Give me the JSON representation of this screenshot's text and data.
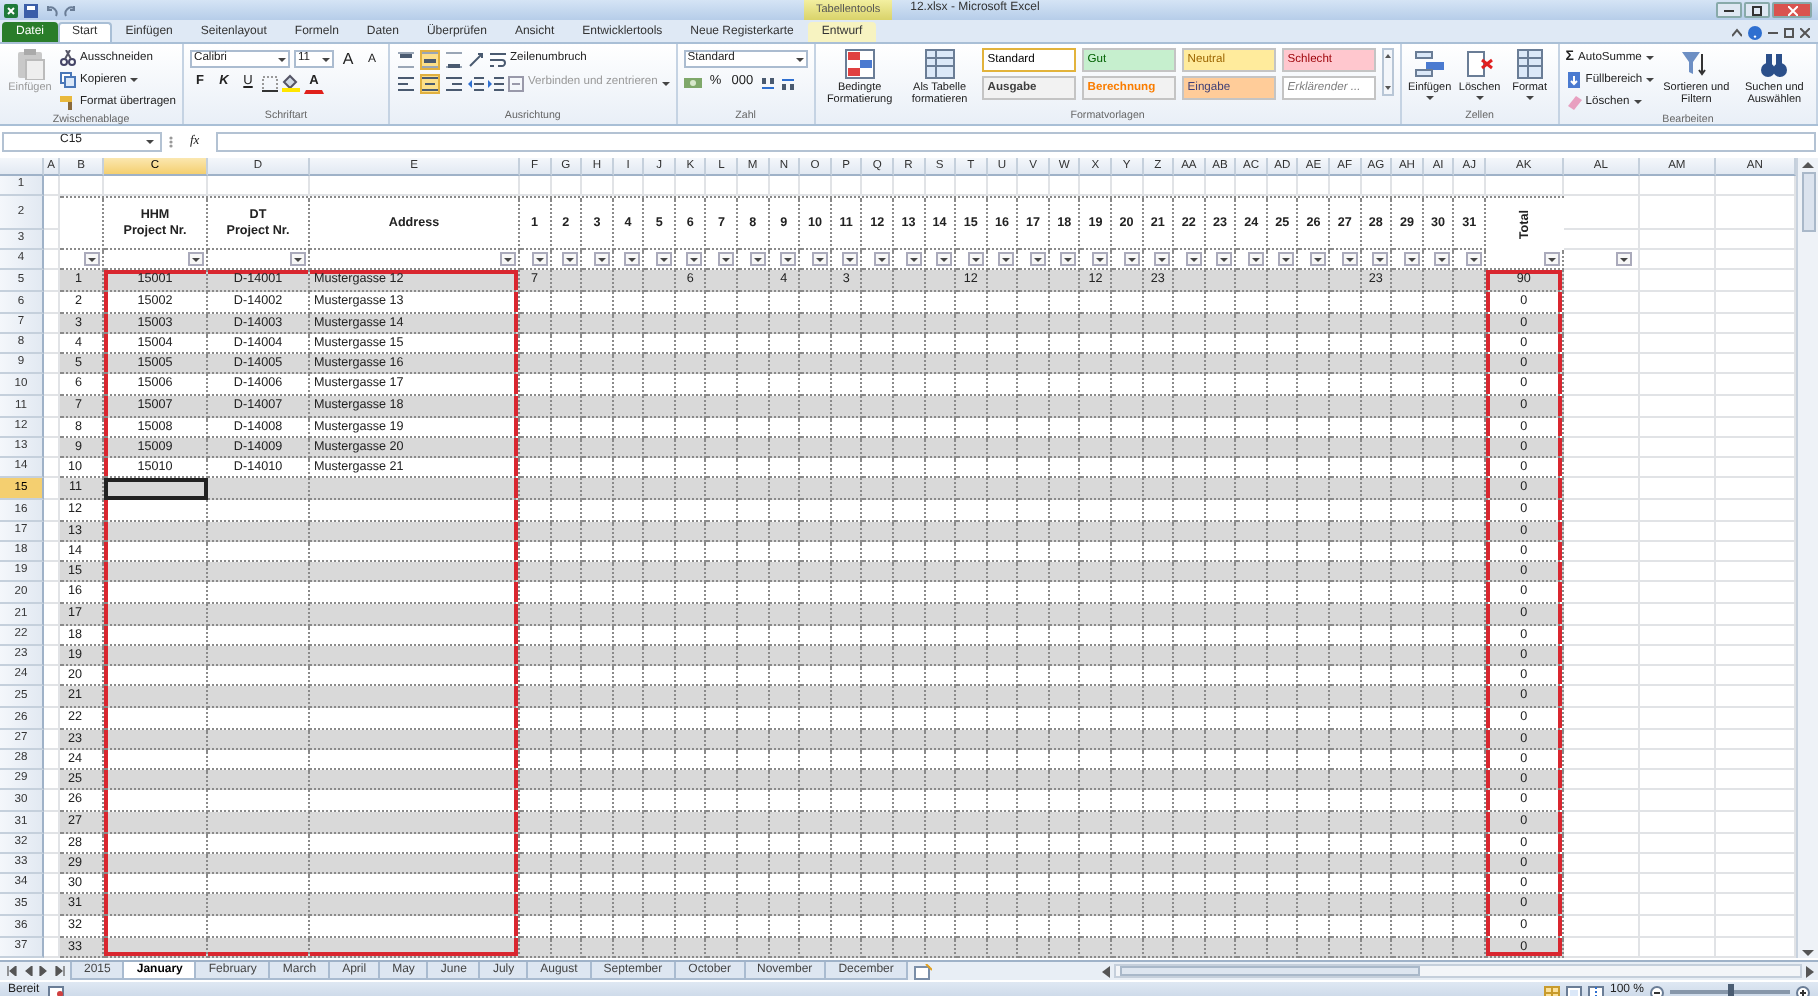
{
  "window": {
    "title": "12.xlsx - Microsoft Excel",
    "context_label": "Tabellentools"
  },
  "ribbon_tabs": [
    {
      "label": "Datei",
      "kind": "file",
      "selected": false
    },
    {
      "label": "Start",
      "kind": "tab",
      "selected": true
    },
    {
      "label": "Einfügen",
      "kind": "tab",
      "selected": false
    },
    {
      "label": "Seitenlayout",
      "kind": "tab",
      "selected": false
    },
    {
      "label": "Formeln",
      "kind": "tab",
      "selected": false
    },
    {
      "label": "Daten",
      "kind": "tab",
      "selected": false
    },
    {
      "label": "Überprüfen",
      "kind": "tab",
      "selected": false
    },
    {
      "label": "Ansicht",
      "kind": "tab",
      "selected": false
    },
    {
      "label": "Entwicklertools",
      "kind": "tab",
      "selected": false
    },
    {
      "label": "Neue Registerkarte",
      "kind": "tab",
      "selected": false
    },
    {
      "label": "Entwurf",
      "kind": "context",
      "selected": false
    }
  ],
  "clipboard": {
    "label": "Zwischenablage",
    "paste": {
      "label": "Einfügen",
      "disabled": true
    },
    "actions": [
      "Ausschneiden",
      "Kopieren",
      "Format übertragen"
    ]
  },
  "font": {
    "label": "Schriftart",
    "family": "Calibri",
    "size": "11",
    "grow": "A",
    "shrink": "A",
    "bold": "F",
    "italic": "K",
    "underline": "U",
    "color_letter": "A"
  },
  "alignment": {
    "label": "Ausrichtung",
    "vertical": [
      {
        "selected": false
      },
      {
        "selected": true
      },
      {
        "selected": false
      }
    ],
    "horizontal": [
      {
        "selected": false
      },
      {
        "selected": true
      },
      {
        "selected": false
      }
    ],
    "wrap": {
      "label": "Zeilenumbruch",
      "disabled": false
    },
    "merge": {
      "label": "Verbinden und zentrieren",
      "disabled": true
    }
  },
  "number": {
    "label": "Zahl",
    "format": "Standard",
    "percent": "%",
    "thousands": "000"
  },
  "styles": {
    "label": "Formatvorlagen",
    "conditional": "Bedingte Formatierung",
    "as_table": "Als Tabelle formatieren",
    "cells": [
      {
        "label": "Standard",
        "kind": "normal",
        "color": "#ffffff",
        "selected": true
      },
      {
        "label": "Gut",
        "kind": "good",
        "color": "#c6efce",
        "selected": false
      },
      {
        "label": "Neutral",
        "kind": "neutral",
        "color": "#ffeb9c",
        "selected": false
      },
      {
        "label": "Schlecht",
        "kind": "bad",
        "color": "#ffc7ce",
        "selected": false
      },
      {
        "label": "Ausgabe",
        "kind": "output",
        "color": "#f2f2f2",
        "selected": false
      },
      {
        "label": "Berechnung",
        "kind": "calculation",
        "color": "#f2f2f2",
        "selected": false
      },
      {
        "label": "Eingabe",
        "kind": "input",
        "color": "#ffcc99",
        "selected": false
      },
      {
        "label": "Erklärender ...",
        "kind": "explanatory",
        "color": "#ffffff",
        "selected": false
      }
    ]
  },
  "cells_group": {
    "label": "Zellen",
    "actions": [
      "Einfügen",
      "Löschen",
      "Format"
    ]
  },
  "editing": {
    "label": "Bearbeiten",
    "small": [
      {
        "glyph": "Σ",
        "label": "AutoSumme"
      },
      {
        "label": "Füllbereich"
      },
      {
        "label": "Löschen"
      }
    ],
    "large": [
      "Sortieren und Filtern",
      "Suchen und Auswählen"
    ]
  },
  "formula_bar": {
    "name_box": "C15",
    "fx": "fx"
  },
  "column_letters": [
    {
      "label": "A",
      "selected": false
    },
    {
      "label": "B",
      "selected": false
    },
    {
      "label": "C",
      "selected": true
    },
    {
      "label": "D",
      "selected": false
    },
    {
      "label": "E",
      "selected": false
    },
    {
      "label": "F",
      "selected": false
    },
    {
      "label": "G",
      "selected": false
    },
    {
      "label": "H",
      "selected": false
    },
    {
      "label": "I",
      "selected": false
    },
    {
      "label": "J",
      "selected": false
    },
    {
      "label": "K",
      "selected": false
    },
    {
      "label": "L",
      "selected": false
    },
    {
      "label": "M",
      "selected": false
    },
    {
      "label": "N",
      "selected": false
    },
    {
      "label": "O",
      "selected": false
    },
    {
      "label": "P",
      "selected": false
    },
    {
      "label": "Q",
      "selected": false
    },
    {
      "label": "R",
      "selected": false
    },
    {
      "label": "S",
      "selected": false
    },
    {
      "label": "T",
      "selected": false
    },
    {
      "label": "U",
      "selected": false
    },
    {
      "label": "V",
      "selected": false
    },
    {
      "label": "W",
      "selected": false
    },
    {
      "label": "X",
      "selected": false
    },
    {
      "label": "Y",
      "selected": false
    },
    {
      "label": "Z",
      "selected": false
    },
    {
      "label": "AA",
      "selected": false
    },
    {
      "label": "AB",
      "selected": false
    },
    {
      "label": "AC",
      "selected": false
    },
    {
      "label": "AD",
      "selected": false
    },
    {
      "label": "AE",
      "selected": false
    },
    {
      "label": "AF",
      "selected": false
    },
    {
      "label": "AG",
      "selected": false
    },
    {
      "label": "AH",
      "selected": false
    },
    {
      "label": "AI",
      "selected": false
    },
    {
      "label": "AJ",
      "selected": false
    },
    {
      "label": "AK",
      "selected": false
    },
    {
      "label": "AL",
      "selected": false
    },
    {
      "label": "AM",
      "selected": false
    },
    {
      "label": "AN",
      "selected": false
    }
  ],
  "row_numbers": [
    {
      "label": "1",
      "selected": false
    },
    {
      "label": "2",
      "selected": false
    },
    {
      "label": "3",
      "selected": false
    },
    {
      "label": "4",
      "selected": false
    },
    {
      "label": "5",
      "selected": false
    },
    {
      "label": "6",
      "selected": false
    },
    {
      "label": "7",
      "selected": false
    },
    {
      "label": "8",
      "selected": false
    },
    {
      "label": "9",
      "selected": false
    },
    {
      "label": "10",
      "selected": false
    },
    {
      "label": "11",
      "selected": false
    },
    {
      "label": "12",
      "selected": false
    },
    {
      "label": "13",
      "selected": false
    },
    {
      "label": "14",
      "selected": false
    },
    {
      "label": "15",
      "selected": true
    },
    {
      "label": "16",
      "selected": false
    },
    {
      "label": "17",
      "selected": false
    },
    {
      "label": "18",
      "selected": false
    },
    {
      "label": "19",
      "selected": false
    },
    {
      "label": "20",
      "selected": false
    },
    {
      "label": "21",
      "selected": false
    },
    {
      "label": "22",
      "selected": false
    },
    {
      "label": "23",
      "selected": false
    },
    {
      "label": "24",
      "selected": false
    },
    {
      "label": "25",
      "selected": false
    },
    {
      "label": "26",
      "selected": false
    },
    {
      "label": "27",
      "selected": false
    },
    {
      "label": "28",
      "selected": false
    },
    {
      "label": "29",
      "selected": false
    },
    {
      "label": "30",
      "selected": false
    },
    {
      "label": "31",
      "selected": false
    },
    {
      "label": "32",
      "selected": false
    },
    {
      "label": "33",
      "selected": false
    },
    {
      "label": "34",
      "selected": false
    },
    {
      "label": "35",
      "selected": false
    },
    {
      "label": "36",
      "selected": false
    },
    {
      "label": "37",
      "selected": false
    }
  ],
  "table": {
    "headers": {
      "hhm": "HHM\nProject Nr.",
      "dt": "DT\nProject Nr.",
      "address": "Address",
      "total": "Total"
    },
    "days": [
      {
        "label": "1",
        "values": [
          "7"
        ]
      },
      {
        "label": "2"
      },
      {
        "label": "3"
      },
      {
        "label": "4"
      },
      {
        "label": "5"
      },
      {
        "label": "6",
        "values": [
          "6"
        ]
      },
      {
        "label": "7"
      },
      {
        "label": "8"
      },
      {
        "label": "9",
        "values": [
          "4"
        ]
      },
      {
        "label": "10"
      },
      {
        "label": "11",
        "values": [
          "3"
        ]
      },
      {
        "label": "12"
      },
      {
        "label": "13"
      },
      {
        "label": "14"
      },
      {
        "label": "15",
        "values": [
          "12"
        ]
      },
      {
        "label": "16"
      },
      {
        "label": "17"
      },
      {
        "label": "18"
      },
      {
        "label": "19",
        "values": [
          "12"
        ]
      },
      {
        "label": "20"
      },
      {
        "label": "21",
        "values": [
          "23"
        ]
      },
      {
        "label": "22"
      },
      {
        "label": "23"
      },
      {
        "label": "24"
      },
      {
        "label": "25"
      },
      {
        "label": "26"
      },
      {
        "label": "27"
      },
      {
        "label": "28",
        "values": [
          "23"
        ]
      },
      {
        "label": "29"
      },
      {
        "label": "30"
      },
      {
        "label": "31"
      }
    ],
    "rows": [
      {
        "no": "1",
        "hhm": "15001",
        "dt": "D-14001",
        "address": "Mustergasse 12",
        "total": "90",
        "selected": false
      },
      {
        "no": "2",
        "hhm": "15002",
        "dt": "D-14002",
        "address": "Mustergasse 13",
        "total": "0",
        "selected": false
      },
      {
        "no": "3",
        "hhm": "15003",
        "dt": "D-14003",
        "address": "Mustergasse 14",
        "total": "0",
        "selected": false
      },
      {
        "no": "4",
        "hhm": "15004",
        "dt": "D-14004",
        "address": "Mustergasse 15",
        "total": "0",
        "selected": false
      },
      {
        "no": "5",
        "hhm": "15005",
        "dt": "D-14005",
        "address": "Mustergasse 16",
        "total": "0",
        "selected": false
      },
      {
        "no": "6",
        "hhm": "15006",
        "dt": "D-14006",
        "address": "Mustergasse 17",
        "total": "0",
        "selected": false
      },
      {
        "no": "7",
        "hhm": "15007",
        "dt": "D-14007",
        "address": "Mustergasse 18",
        "total": "0",
        "selected": false
      },
      {
        "no": "8",
        "hhm": "15008",
        "dt": "D-14008",
        "address": "Mustergasse 19",
        "total": "0",
        "selected": false
      },
      {
        "no": "9",
        "hhm": "15009",
        "dt": "D-14009",
        "address": "Mustergasse 20",
        "total": "0",
        "selected": false
      },
      {
        "no": "10",
        "hhm": "15010",
        "dt": "D-14010",
        "address": "Mustergasse 21",
        "total": "0",
        "selected": false
      },
      {
        "no": "11",
        "total": "0",
        "selected": true
      },
      {
        "no": "12",
        "total": "0",
        "selected": false
      },
      {
        "no": "13",
        "total": "0",
        "selected": false
      },
      {
        "no": "14",
        "total": "0",
        "selected": false
      },
      {
        "no": "15",
        "total": "0",
        "selected": false
      },
      {
        "no": "16",
        "total": "0",
        "selected": false
      },
      {
        "no": "17",
        "total": "0",
        "selected": false
      },
      {
        "no": "18",
        "total": "0",
        "selected": false
      },
      {
        "no": "19",
        "total": "0",
        "selected": false
      },
      {
        "no": "20",
        "total": "0",
        "selected": false
      },
      {
        "no": "21",
        "total": "0",
        "selected": false
      },
      {
        "no": "22",
        "total": "0",
        "selected": false
      },
      {
        "no": "23",
        "total": "0",
        "selected": false
      },
      {
        "no": "24",
        "total": "0",
        "selected": false
      },
      {
        "no": "25",
        "total": "0",
        "selected": false
      },
      {
        "no": "26",
        "total": "0",
        "selected": false
      },
      {
        "no": "27",
        "total": "0",
        "selected": false
      },
      {
        "no": "28",
        "total": "0",
        "selected": false
      },
      {
        "no": "29",
        "total": "0",
        "selected": false
      },
      {
        "no": "30",
        "total": "0",
        "selected": false
      },
      {
        "no": "31",
        "total": "0",
        "selected": false
      },
      {
        "no": "32",
        "total": "0",
        "selected": false
      },
      {
        "no": "33",
        "total": "0",
        "selected": false
      }
    ]
  },
  "sheet_tabs": [
    {
      "label": "2015",
      "selected": false
    },
    {
      "label": "January",
      "selected": true
    },
    {
      "label": "February",
      "selected": false
    },
    {
      "label": "March",
      "selected": false
    },
    {
      "label": "April",
      "selected": false
    },
    {
      "label": "May",
      "selected": false
    },
    {
      "label": "June",
      "selected": false
    },
    {
      "label": "July",
      "selected": false
    },
    {
      "label": "August",
      "selected": false
    },
    {
      "label": "September",
      "selected": false
    },
    {
      "label": "October",
      "selected": false
    },
    {
      "label": "November",
      "selected": false
    },
    {
      "label": "December",
      "selected": false
    }
  ],
  "status_bar": {
    "status": "Bereit",
    "zoom": {
      "reading": "100 %",
      "level": 0.5
    }
  }
}
